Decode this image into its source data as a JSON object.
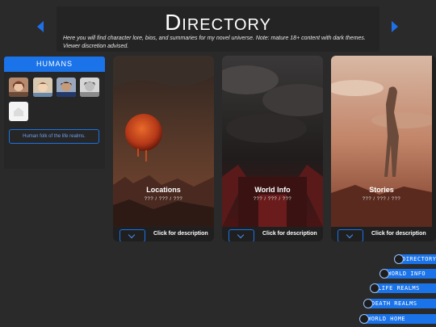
{
  "header": {
    "title": "Directory",
    "intro": "Here you will find character lore, bios, and summaries for my novel universe. Note: mature 18+ content with dark themes. Viewer discretion advised."
  },
  "sidebar": {
    "tab_label": "HUMANS",
    "link_label": "Human folk of the life realms."
  },
  "cards": [
    {
      "title": "Locations",
      "sub": "??? / ??? / ???",
      "desc": "Click for description"
    },
    {
      "title": "World Info",
      "sub": "??? / ??? / ???",
      "desc": "Click for description"
    },
    {
      "title": "Stories",
      "sub": "??? / ??? / ???",
      "desc": "Click for description"
    }
  ],
  "nav": [
    "DIRECTORY",
    "WORLD INFO",
    "LIFE REALMS",
    "DEATH REALMS",
    "WORLD HOME"
  ],
  "colors": {
    "accent": "#1a73e8",
    "background": "#2a2a2a"
  },
  "icons": {
    "prev": "arrow-left-icon",
    "next": "arrow-right-icon",
    "expand": "chevron-down-icon"
  }
}
